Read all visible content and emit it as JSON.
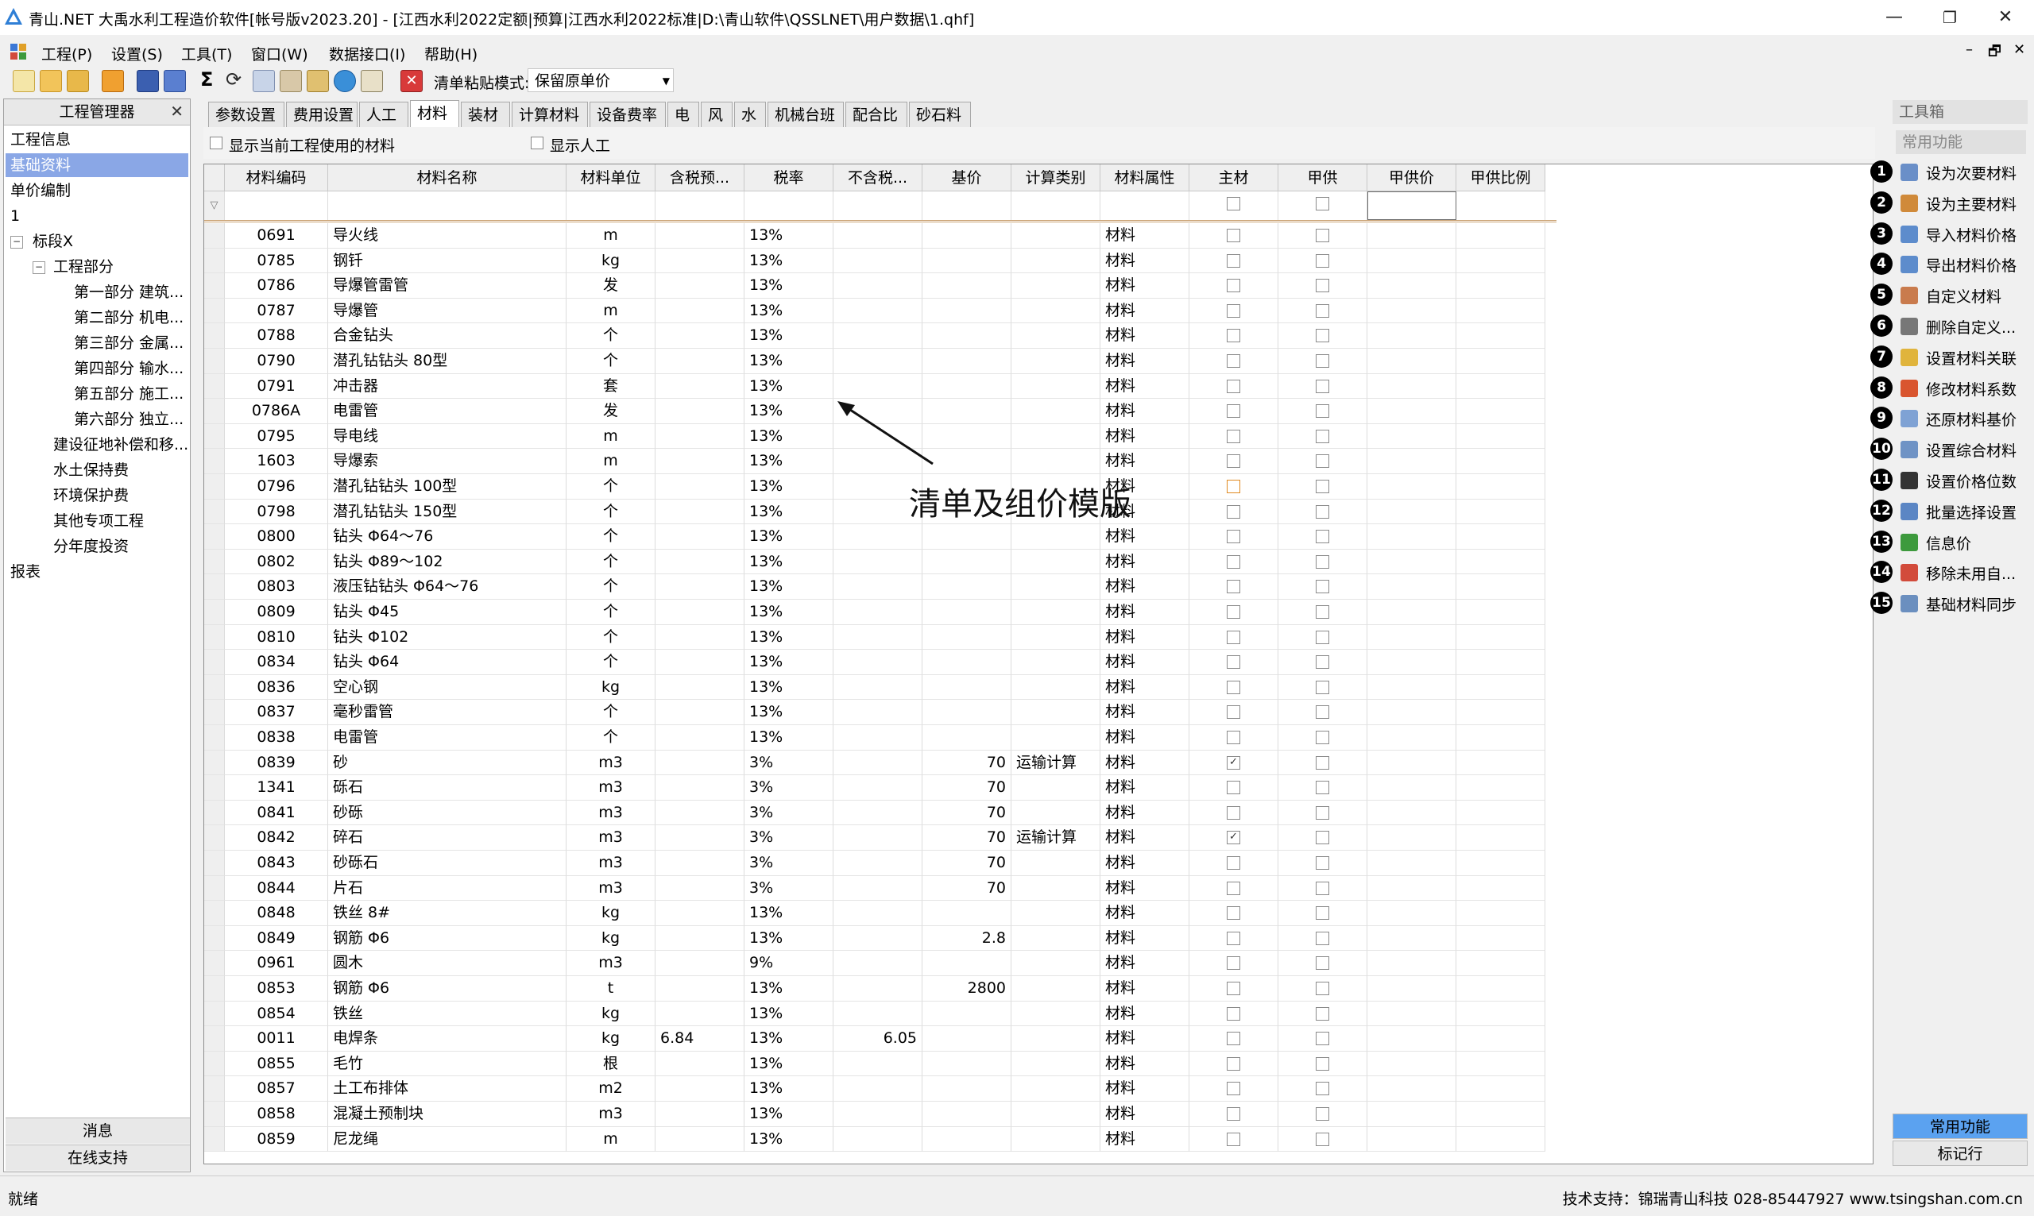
{
  "window": {
    "title": "青山.NET 大禹水利工程造价软件[帐号版v2023.20] - [江西水利2022定额|预算|江西水利2022标准|D:\\青山软件\\QSSLNET\\用户数据\\1.qhf]",
    "minimize": "—",
    "maximize": "❐",
    "close": "✕"
  },
  "menu": {
    "items": [
      "工程(P)",
      "设置(S)",
      "工具(T)",
      "窗口(W)",
      "数据接口(I)",
      "帮助(H)"
    ],
    "mdi_controls": [
      "–",
      "🗗",
      "✕"
    ]
  },
  "toolbar": {
    "paste_mode_label": "清单粘贴模式:",
    "paste_mode_value": "保留原单价"
  },
  "left_panel": {
    "title": "工程管理器",
    "close": "✕",
    "items_top": [
      "工程信息",
      "基础资料",
      "单价编制",
      "1"
    ],
    "selected": "基础资料",
    "tree": {
      "root": "标段X",
      "engineering": "工程部分",
      "parts": [
        "第一部分 建筑...",
        "第二部分 机电...",
        "第三部分 金属...",
        "第四部分 输水...",
        "第五部分 施工...",
        "第六部分 独立..."
      ],
      "others": [
        "建设征地补偿和移...",
        "水土保持费",
        "环境保护费",
        "其他专项工程",
        "分年度投资"
      ]
    },
    "reports": "报表",
    "bottom_buttons": [
      "消息",
      "在线支持"
    ]
  },
  "tabs": [
    "参数设置",
    "费用设置",
    "人工",
    "材料",
    "装材",
    "计算材料",
    "设备费率",
    "电",
    "风",
    "水",
    "机械台班",
    "配合比",
    "砂石料"
  ],
  "active_tab": "材料",
  "options": {
    "show_used_materials": "显示当前工程使用的材料",
    "show_labor": "显示人工"
  },
  "grid": {
    "columns": [
      "材料编码",
      "材料名称",
      "材料单位",
      "含税预...",
      "税率",
      "不含税...",
      "基价",
      "计算类别",
      "材料属性",
      "主材",
      "甲供",
      "甲供价",
      "甲供比例"
    ],
    "rows": [
      {
        "code": "0691",
        "name": "导火线",
        "unit": "m",
        "tax_price": "",
        "rate": "13%",
        "notax": "",
        "base": "",
        "calc": "",
        "attr": "材料",
        "main": false,
        "jia": false
      },
      {
        "code": "0785",
        "name": "钢钎",
        "unit": "kg",
        "tax_price": "",
        "rate": "13%",
        "notax": "",
        "base": "",
        "calc": "",
        "attr": "材料",
        "main": false,
        "jia": false
      },
      {
        "code": "0786",
        "name": "导爆管雷管",
        "unit": "发",
        "tax_price": "",
        "rate": "13%",
        "notax": "",
        "base": "",
        "calc": "",
        "attr": "材料",
        "main": false,
        "jia": false
      },
      {
        "code": "0787",
        "name": "导爆管",
        "unit": "m",
        "tax_price": "",
        "rate": "13%",
        "notax": "",
        "base": "",
        "calc": "",
        "attr": "材料",
        "main": false,
        "jia": false
      },
      {
        "code": "0788",
        "name": "合金钻头",
        "unit": "个",
        "tax_price": "",
        "rate": "13%",
        "notax": "",
        "base": "",
        "calc": "",
        "attr": "材料",
        "main": false,
        "jia": false
      },
      {
        "code": "0790",
        "name": "潜孔钻钻头 80型",
        "unit": "个",
        "tax_price": "",
        "rate": "13%",
        "notax": "",
        "base": "",
        "calc": "",
        "attr": "材料",
        "main": false,
        "jia": false
      },
      {
        "code": "0791",
        "name": "冲击器",
        "unit": "套",
        "tax_price": "",
        "rate": "13%",
        "notax": "",
        "base": "",
        "calc": "",
        "attr": "材料",
        "main": false,
        "jia": false
      },
      {
        "code": "0786A",
        "name": "电雷管",
        "unit": "发",
        "tax_price": "",
        "rate": "13%",
        "notax": "",
        "base": "",
        "calc": "",
        "attr": "材料",
        "main": false,
        "jia": false
      },
      {
        "code": "0795",
        "name": "导电线",
        "unit": "m",
        "tax_price": "",
        "rate": "13%",
        "notax": "",
        "base": "",
        "calc": "",
        "attr": "材料",
        "main": false,
        "jia": false
      },
      {
        "code": "1603",
        "name": "导爆索",
        "unit": "m",
        "tax_price": "",
        "rate": "13%",
        "notax": "",
        "base": "",
        "calc": "",
        "attr": "材料",
        "main": false,
        "jia": false
      },
      {
        "code": "0796",
        "name": "潜孔钻钻头 100型",
        "unit": "个",
        "tax_price": "",
        "rate": "13%",
        "notax": "",
        "base": "",
        "calc": "",
        "attr": "材料",
        "main": false,
        "jia": false,
        "main_highlight": true
      },
      {
        "code": "0798",
        "name": "潜孔钻钻头 150型",
        "unit": "个",
        "tax_price": "",
        "rate": "13%",
        "notax": "",
        "base": "",
        "calc": "",
        "attr": "材料",
        "main": false,
        "jia": false
      },
      {
        "code": "0800",
        "name": "钻头 Φ64～76",
        "unit": "个",
        "tax_price": "",
        "rate": "13%",
        "notax": "",
        "base": "",
        "calc": "",
        "attr": "材料",
        "main": false,
        "jia": false
      },
      {
        "code": "0802",
        "name": "钻头 Φ89～102",
        "unit": "个",
        "tax_price": "",
        "rate": "13%",
        "notax": "",
        "base": "",
        "calc": "",
        "attr": "材料",
        "main": false,
        "jia": false
      },
      {
        "code": "0803",
        "name": "液压钻钻头 Φ64～76",
        "unit": "个",
        "tax_price": "",
        "rate": "13%",
        "notax": "",
        "base": "",
        "calc": "",
        "attr": "材料",
        "main": false,
        "jia": false
      },
      {
        "code": "0809",
        "name": "钻头 Φ45",
        "unit": "个",
        "tax_price": "",
        "rate": "13%",
        "notax": "",
        "base": "",
        "calc": "",
        "attr": "材料",
        "main": false,
        "jia": false
      },
      {
        "code": "0810",
        "name": "钻头 Φ102",
        "unit": "个",
        "tax_price": "",
        "rate": "13%",
        "notax": "",
        "base": "",
        "calc": "",
        "attr": "材料",
        "main": false,
        "jia": false
      },
      {
        "code": "0834",
        "name": "钻头 Φ64",
        "unit": "个",
        "tax_price": "",
        "rate": "13%",
        "notax": "",
        "base": "",
        "calc": "",
        "attr": "材料",
        "main": false,
        "jia": false
      },
      {
        "code": "0836",
        "name": "空心钢",
        "unit": "kg",
        "tax_price": "",
        "rate": "13%",
        "notax": "",
        "base": "",
        "calc": "",
        "attr": "材料",
        "main": false,
        "jia": false
      },
      {
        "code": "0837",
        "name": "毫秒雷管",
        "unit": "个",
        "tax_price": "",
        "rate": "13%",
        "notax": "",
        "base": "",
        "calc": "",
        "attr": "材料",
        "main": false,
        "jia": false
      },
      {
        "code": "0838",
        "name": "电雷管",
        "unit": "个",
        "tax_price": "",
        "rate": "13%",
        "notax": "",
        "base": "",
        "calc": "",
        "attr": "材料",
        "main": false,
        "jia": false
      },
      {
        "code": "0839",
        "name": "砂",
        "unit": "m3",
        "tax_price": "",
        "rate": "3%",
        "notax": "",
        "base": "70",
        "calc": "运输计算",
        "attr": "材料",
        "main": true,
        "jia": false
      },
      {
        "code": "1341",
        "name": "砾石",
        "unit": "m3",
        "tax_price": "",
        "rate": "3%",
        "notax": "",
        "base": "70",
        "calc": "",
        "attr": "材料",
        "main": false,
        "jia": false
      },
      {
        "code": "0841",
        "name": "砂砾",
        "unit": "m3",
        "tax_price": "",
        "rate": "3%",
        "notax": "",
        "base": "70",
        "calc": "",
        "attr": "材料",
        "main": false,
        "jia": false
      },
      {
        "code": "0842",
        "name": "碎石",
        "unit": "m3",
        "tax_price": "",
        "rate": "3%",
        "notax": "",
        "base": "70",
        "calc": "运输计算",
        "attr": "材料",
        "main": true,
        "jia": false
      },
      {
        "code": "0843",
        "name": "砂砾石",
        "unit": "m3",
        "tax_price": "",
        "rate": "3%",
        "notax": "",
        "base": "70",
        "calc": "",
        "attr": "材料",
        "main": false,
        "jia": false
      },
      {
        "code": "0844",
        "name": "片石",
        "unit": "m3",
        "tax_price": "",
        "rate": "3%",
        "notax": "",
        "base": "70",
        "calc": "",
        "attr": "材料",
        "main": false,
        "jia": false
      },
      {
        "code": "0848",
        "name": "铁丝 8#",
        "unit": "kg",
        "tax_price": "",
        "rate": "13%",
        "notax": "",
        "base": "",
        "calc": "",
        "attr": "材料",
        "main": false,
        "jia": false
      },
      {
        "code": "0849",
        "name": "钢筋 Φ6",
        "unit": "kg",
        "tax_price": "",
        "rate": "13%",
        "notax": "",
        "base": "2.8",
        "calc": "",
        "attr": "材料",
        "main": false,
        "jia": false
      },
      {
        "code": "0961",
        "name": "圆木",
        "unit": "m3",
        "tax_price": "",
        "rate": "9%",
        "notax": "",
        "base": "",
        "calc": "",
        "attr": "材料",
        "main": false,
        "jia": false
      },
      {
        "code": "0853",
        "name": "钢筋 Φ6",
        "unit": "t",
        "tax_price": "",
        "rate": "13%",
        "notax": "",
        "base": "2800",
        "calc": "",
        "attr": "材料",
        "main": false,
        "jia": false
      },
      {
        "code": "0854",
        "name": "铁丝",
        "unit": "kg",
        "tax_price": "",
        "rate": "13%",
        "notax": "",
        "base": "",
        "calc": "",
        "attr": "材料",
        "main": false,
        "jia": false
      },
      {
        "code": "0011",
        "name": "电焊条",
        "unit": "kg",
        "tax_price": "6.84",
        "rate": "13%",
        "notax": "6.05",
        "base": "",
        "calc": "",
        "attr": "材料",
        "main": false,
        "jia": false
      },
      {
        "code": "0855",
        "name": "毛竹",
        "unit": "根",
        "tax_price": "",
        "rate": "13%",
        "notax": "",
        "base": "",
        "calc": "",
        "attr": "材料",
        "main": false,
        "jia": false
      },
      {
        "code": "0857",
        "name": "土工布排体",
        "unit": "m2",
        "tax_price": "",
        "rate": "13%",
        "notax": "",
        "base": "",
        "calc": "",
        "attr": "材料",
        "main": false,
        "jia": false
      },
      {
        "code": "0858",
        "name": "混凝土预制块",
        "unit": "m3",
        "tax_price": "",
        "rate": "13%",
        "notax": "",
        "base": "",
        "calc": "",
        "attr": "材料",
        "main": false,
        "jia": false
      },
      {
        "code": "0859",
        "name": "尼龙绳",
        "unit": "m",
        "tax_price": "",
        "rate": "13%",
        "notax": "",
        "base": "",
        "calc": "",
        "attr": "材料",
        "main": false,
        "jia": false
      }
    ]
  },
  "annotation": "清单及组价模版",
  "right_panel": {
    "title": "工具箱",
    "group": "常用功能",
    "items": [
      {
        "n": "1",
        "label": "设为次要材料",
        "icon": "bookmark-icon",
        "color": "#6a8fc8"
      },
      {
        "n": "2",
        "label": "设为主要材料",
        "icon": "star-icon",
        "color": "#d08a3a"
      },
      {
        "n": "3",
        "label": "导入材料价格",
        "icon": "import-icon",
        "color": "#5d8ccc"
      },
      {
        "n": "4",
        "label": "导出材料价格",
        "icon": "export-icon",
        "color": "#5d8ccc"
      },
      {
        "n": "5",
        "label": "自定义材料",
        "icon": "custom-icon",
        "color": "#c97b4d"
      },
      {
        "n": "6",
        "label": "删除自定义...",
        "icon": "delete-icon",
        "color": "#777777"
      },
      {
        "n": "7",
        "label": "设置材料关联",
        "icon": "link-icon",
        "color": "#e0b43c"
      },
      {
        "n": "8",
        "label": "修改材料系数",
        "icon": "edit-icon",
        "color": "#d9552f"
      },
      {
        "n": "9",
        "label": "还原材料基价",
        "icon": "restore-icon",
        "color": "#7fa2d4"
      },
      {
        "n": "10",
        "label": "设置综合材料",
        "icon": "combine-icon",
        "color": "#6f93c5"
      },
      {
        "n": "11",
        "label": "设置价格位数",
        "icon": "digits-icon",
        "color": "#333333"
      },
      {
        "n": "12",
        "label": "批量选择设置",
        "icon": "batch-icon",
        "color": "#5b86c4"
      },
      {
        "n": "13",
        "label": "信息价",
        "icon": "info-price-icon",
        "color": "#3d9a3d"
      },
      {
        "n": "14",
        "label": "移除未用自...",
        "icon": "remove-icon",
        "color": "#d24b3b"
      },
      {
        "n": "15",
        "label": "基础材料同步",
        "icon": "sync-icon",
        "color": "#6b8fbf"
      }
    ],
    "bottom_buttons": [
      "常用功能",
      "标记行"
    ]
  },
  "status": {
    "left": "就绪",
    "right": "技术支持：锦瑞青山科技 028-85447927 www.tsingshan.com.cn"
  },
  "colors": {
    "selection": "#8aa7e6",
    "accent_blue": "#3b78d6",
    "active_bottom": "#5ba2f0"
  }
}
